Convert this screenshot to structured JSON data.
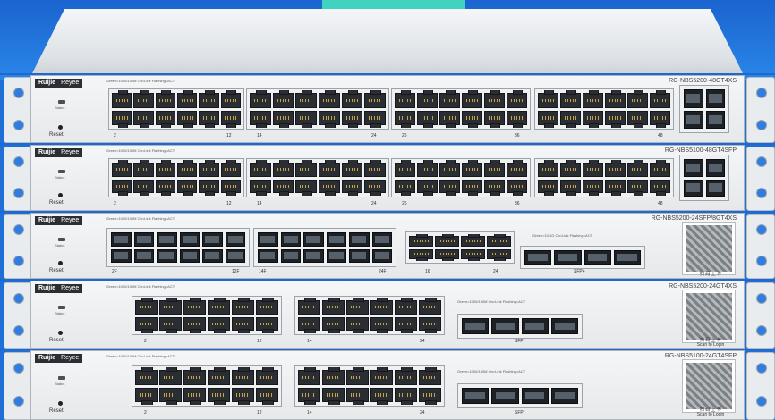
{
  "brand": {
    "logo": "Ruijie",
    "sub": "Reyee"
  },
  "labels": {
    "status": "Status",
    "reset": "Reset",
    "sfp": "SFP",
    "sfp_plus": "SFP+",
    "scan_cn": "扫 码 上 传",
    "scan_en": "Scan to Login"
  },
  "units": [
    {
      "model": "RG-NBS5200-48GT4XS",
      "legend": "Green=1000/100M  On=Link  Flashing=ACT",
      "port_numbers": [
        "2",
        "12",
        "14",
        "24",
        "26",
        "36",
        "48"
      ]
    },
    {
      "model": "RG-NBS5100-48GT4SFP",
      "legend": "Green=1000/100M  On=Link  Flashing=ACT",
      "port_numbers": [
        "2",
        "12",
        "14",
        "24",
        "26",
        "36",
        "48"
      ]
    },
    {
      "model": "RG-NBS5200-24SFP/8GT4XS",
      "legend": "Green=1000/100M  On=Link  Flashing=ACT",
      "legend2": "Green=10/1G  On=Link  Flashing=ACT",
      "port_numbers": [
        "2F",
        "12F",
        "14F",
        "24F",
        "16",
        "24"
      ]
    },
    {
      "model": "RG-NBS5200-24GT4XS",
      "legend": "Green=1000/100M  On=Link  Flashing=ACT",
      "port_numbers": [
        "2",
        "12",
        "14",
        "24"
      ]
    },
    {
      "model": "RG-NBS5100-24GT4SFP",
      "legend": "Green=1000/100M  On=Link  Flashing=ACT",
      "port_numbers": [
        "2",
        "12",
        "14",
        "24"
      ]
    }
  ]
}
